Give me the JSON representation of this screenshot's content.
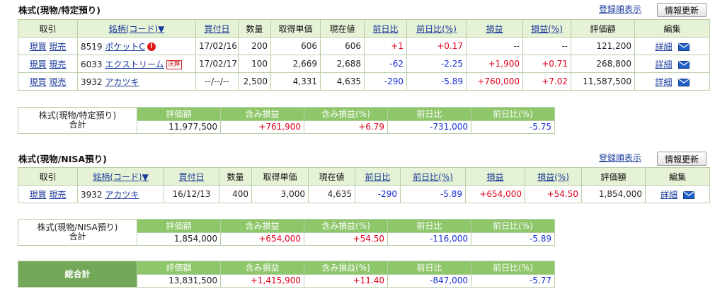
{
  "section1": {
    "title": "株式(現物/特定預り)",
    "register_link": "登録順表示",
    "refresh_button": "情報更新",
    "headers": [
      "取引",
      "銘柄(コード)▼",
      "買付日",
      "数量",
      "取得単価",
      "現在値",
      "前日比",
      "前日比(%)",
      "損益",
      "損益(%)",
      "評価額",
      "編集"
    ],
    "rows": [
      {
        "buy": "現買",
        "sell": "現売",
        "code": "8519",
        "name": "ポケットC",
        "mark": "!",
        "badge": "",
        "date": "17/02/16",
        "qty": "200",
        "cost": "606",
        "price": "606",
        "chg": "+1",
        "chg_pct": "+0.17",
        "pl": "--",
        "pl_pct": "--",
        "value": "121,200",
        "detail": "詳細"
      },
      {
        "buy": "現買",
        "sell": "現売",
        "code": "6033",
        "name": "エクストリーム",
        "mark": "",
        "badge": "決算",
        "date": "17/02/17",
        "qty": "100",
        "cost": "2,669",
        "price": "2,688",
        "chg": "-62",
        "chg_pct": "-2.25",
        "pl": "+1,900",
        "pl_pct": "+0.71",
        "value": "268,800",
        "detail": "詳細"
      },
      {
        "buy": "現買",
        "sell": "現売",
        "code": "3932",
        "name": "アカツキ",
        "mark": "",
        "badge": "",
        "date": "--/--/--",
        "qty": "2,500",
        "cost": "4,331",
        "price": "4,635",
        "chg": "-290",
        "chg_pct": "-5.89",
        "pl": "+760,000",
        "pl_pct": "+7.02",
        "value": "11,587,500",
        "detail": "詳細"
      }
    ]
  },
  "summary1": {
    "label_line1": "株式(現物/特定預り)",
    "label_line2": "合計",
    "headers": [
      "評価額",
      "含み損益",
      "含み損益(%)",
      "前日比",
      "前日比(%)"
    ],
    "values": [
      "11,977,500",
      "+761,900",
      "+6.79",
      "-731,000",
      "-5.75"
    ]
  },
  "section2": {
    "title": "株式(現物/NISA預り)",
    "register_link": "登録順表示",
    "refresh_button": "情報更新",
    "headers": [
      "取引",
      "銘柄(コード)▼",
      "買付日",
      "数量",
      "取得単価",
      "現在値",
      "前日比",
      "前日比(%)",
      "損益",
      "損益(%)",
      "評価額",
      "編集"
    ],
    "rows": [
      {
        "buy": "現買",
        "sell": "現売",
        "code": "3932",
        "name": "アカツキ",
        "date": "16/12/13",
        "qty": "400",
        "cost": "3,000",
        "price": "4,635",
        "chg": "-290",
        "chg_pct": "-5.89",
        "pl": "+654,000",
        "pl_pct": "+54.50",
        "value": "1,854,000",
        "detail": "詳細"
      }
    ]
  },
  "summary2": {
    "label_line1": "株式(現物/NISA預り)",
    "label_line2": "合計",
    "headers": [
      "評価額",
      "含み損益",
      "含み損益(%)",
      "前日比",
      "前日比(%)"
    ],
    "values": [
      "1,854,000",
      "+654,000",
      "+54.50",
      "-116,000",
      "-5.89"
    ]
  },
  "grand_total": {
    "label": "総合計",
    "headers": [
      "評価額",
      "含み損益",
      "含み損益(%)",
      "前日比",
      "前日比(%)"
    ],
    "values": [
      "13,831,500",
      "+1,415,900",
      "+11.40",
      "-847,000",
      "-5.77"
    ]
  },
  "colors": {
    "positive": "#e0001a",
    "negative": "#1730d0",
    "header_bg": "#e6f2d6",
    "summary_header": "#8ec66a",
    "total_label": "#72a858"
  },
  "icons": {
    "alert": "alert-circle-icon",
    "mail": "mail-envelope-icon"
  }
}
